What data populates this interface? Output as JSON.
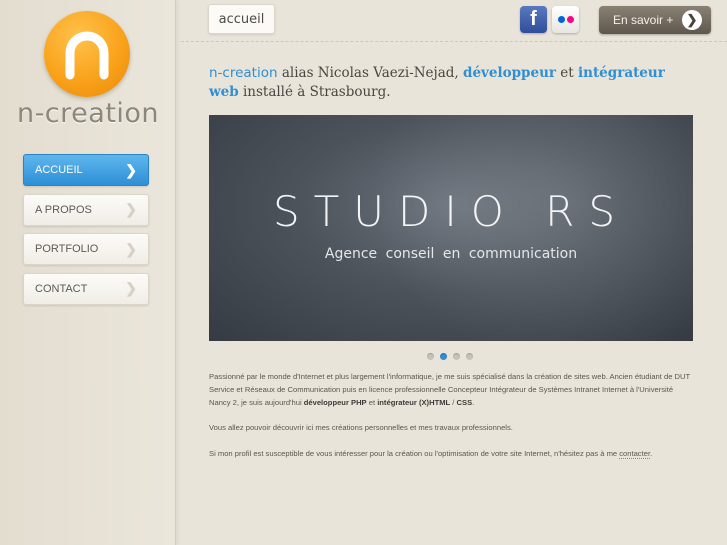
{
  "logo": {
    "text": "n-creation"
  },
  "nav": {
    "items": [
      {
        "label": "ACCUEIL",
        "active": true
      },
      {
        "label": "A PROPOS",
        "active": false
      },
      {
        "label": "PORTFOLIO",
        "active": false
      },
      {
        "label": "CONTACT",
        "active": false
      }
    ]
  },
  "header": {
    "tab_label": "accueil",
    "social": {
      "facebook_icon": "facebook-icon",
      "flickr_icon": "flickr-icon"
    },
    "savoir_button": "En savoir +"
  },
  "intro": {
    "brand": "n-creation",
    "t1": " alias Nicolas Vaezi-Nejad, ",
    "h1": "développeur",
    "t2": " et ",
    "h2": "intégrateur web",
    "t3": " installé à Strasbourg."
  },
  "slider": {
    "title": "STUDIO RS",
    "subtitle": "Agence conseil en communication",
    "slide_count": 4,
    "active_slide": 2
  },
  "body": {
    "p1_a": "Passionné par le monde d'Internet et plus largement l'informatique, je me suis spécialisé dans la création de sites web. Ancien étudiant de DUT Service et Réseaux de Communication puis en licence professionnelle Concepteur Intégrateur de Systèmes Intranet Internet à l'Université Nancy 2, je suis aujourd'hui ",
    "p1_b1": "développeur PHP",
    "p1_c": " et ",
    "p1_b2": "intégrateur (X)HTML",
    "p1_d": " / ",
    "p1_b3": "CSS",
    "p1_e": ".",
    "p2": "Vous allez pouvoir découvrir ici mes créations personnelles et mes travaux professionnels.",
    "p3_a": "Si mon profil est susceptible de vous intéresser pour la création ou l'optimisation de votre site Internet, n'hésitez pas à me ",
    "p3_link": "contacter",
    "p3_b": "."
  },
  "colors": {
    "accent": "#2f8ed4",
    "logo_orange": "#f9a21a",
    "background": "#e9e4d9"
  }
}
